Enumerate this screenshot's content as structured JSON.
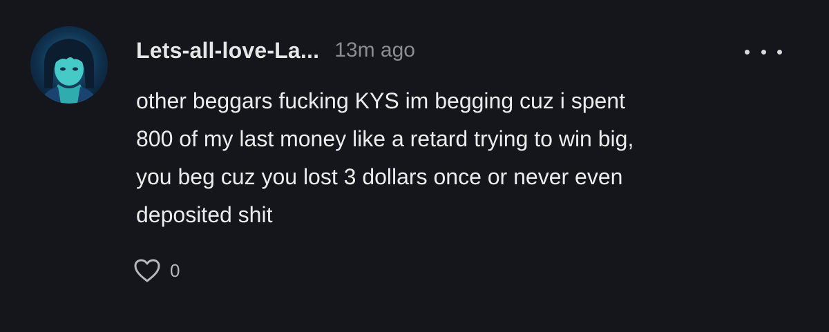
{
  "comment": {
    "username": "Lets-all-love-La...",
    "timestamp": "13m ago",
    "more_icon": "more-horizontal-icon",
    "avatar_icon": "profile-avatar",
    "body_lines": [
      "other beggars fucking KYS im begging cuz i spent",
      "800 of my last money like a retard trying to win big,",
      "you beg cuz you lost 3 dollars once or never even",
      "deposited shit"
    ],
    "like_icon": "heart-icon",
    "like_count": "0"
  },
  "colors": {
    "background": "#15161b",
    "text": "#ececed",
    "muted": "#8c8d93",
    "avatar_accent": "#4fe3d4"
  }
}
